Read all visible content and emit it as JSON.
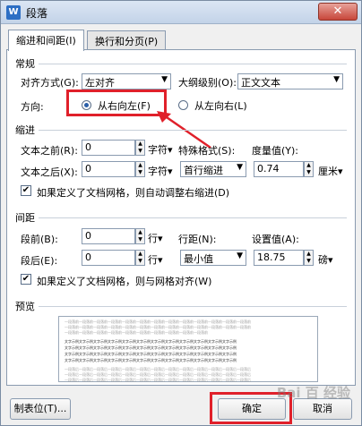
{
  "window": {
    "title": "段落",
    "close_label": "✕"
  },
  "tabs": [
    {
      "label": "缩进和间距(I)",
      "active": true
    },
    {
      "label": "换行和分页(P)",
      "active": false
    }
  ],
  "general": {
    "section_title": "常规",
    "alignment_label": "对齐方式(G):",
    "alignment_value": "左对齐",
    "outline_label": "大纲级别(O):",
    "outline_value": "正文文本",
    "direction_label": "方向:",
    "direction_rtl": "从右向左(F)",
    "direction_ltr": "从左向右(L)"
  },
  "indent": {
    "section_title": "缩进",
    "before_label": "文本之前(R):",
    "before_value": "0",
    "before_unit": "字符▾",
    "special_label": "特殊格式(S):",
    "special_value": "首行缩进",
    "measure_label": "度量值(Y):",
    "measure_value": "0.74",
    "measure_unit": "厘米▾",
    "after_label": "文本之后(X):",
    "after_value": "0",
    "after_unit": "字符▾",
    "auto_adjust_label": "如果定义了文档网格，则自动调整右缩进(D)"
  },
  "spacing": {
    "section_title": "间距",
    "before_label": "段前(B):",
    "before_value": "0",
    "before_unit": "行▾",
    "line_label": "行距(N):",
    "line_value": "最小值",
    "set_label": "设置值(A):",
    "set_value": "18.75",
    "set_unit": "磅▾",
    "after_label": "段后(E):",
    "after_value": "0",
    "after_unit": "行▾",
    "grid_align_label": "如果定义了文档网格，则与网格对齐(W)"
  },
  "preview": {
    "section_title": "预览",
    "prev_lines": [
      "一段落前一段落前一段落前一段落前一段落前一段落前一段落前一段落前一段落前一段落前一段落前一段落前一段落前",
      "一段落前一段落前一段落前一段落前一段落前一段落前一段落前一段落前一段落前一段落前一段落前一段落前一段落前",
      "一段落前一段落前一段落前一段落前一段落前一段落前一段落前一段落前一段落前一段落前"
    ],
    "sample_lines": [
      "文字示例文字示例文字示例文字示例文字示例文字示例文字示例文字示例文字示例文字示例文字示例文字示例",
      "文字示例文字示例文字示例文字示例文字示例文字示例文字示例文字示例文字示例文字示例文字示例文字示例",
      "文字示例文字示例文字示例文字示例文字示例文字示例文字示例文字示例文字示例文字示例文字示例文字示例",
      "文字示例文字示例文字示例文字示例文字示例文字示例文字示例文字示例文字示例文字示例文字示例文字示例"
    ],
    "next_lines": [
      "一段落后一段落后一段落后一段落后一段落后一段落后一段落后一段落后一段落后一段落后一段落后一段落后一段落后",
      "一段落后一段落后一段落后一段落后一段落后一段落后一段落后一段落后一段落后一段落后一段落后一段落后一段落后",
      "一段落后一段落后一段落后一段落后一段落后一段落后一段落后一段落后一段落后一段落后一段落后一段落后一段落后"
    ]
  },
  "buttons": {
    "tabs": "制表位(T)...",
    "ok": "确定",
    "cancel": "取消"
  },
  "watermark": "Bai 百 经验",
  "colors": {
    "highlight": "#e0202a",
    "accent": "#2a5ea8"
  }
}
